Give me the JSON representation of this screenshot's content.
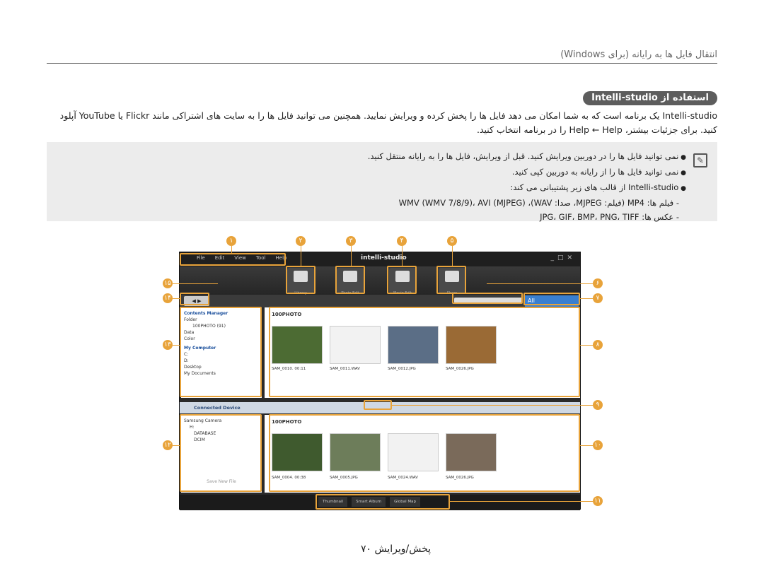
{
  "header": {
    "title": "انتقال فایل ها به رایانه (برای Windows)"
  },
  "section": {
    "title": "استفاده از Intelli-studio"
  },
  "intro": {
    "line1": "Intelli-studio یک برنامه است که به شما امکان می دهد فایل ها را پخش کرده و ویرایش نمایید. همچنین می توانید فایل ها را به سایت های اشتراکی مانند Flickr یا YouTube آپلود",
    "line2": "کنید. برای جزئیات بیشتر، Help ← Help را در برنامه انتخاب کنید."
  },
  "notes": {
    "icon": "note-icon",
    "items": [
      "نمی توانید فایل ها را در دوربین ویرایش کنید. قبل از ویرایش، فایل ها را به رایانه منتقل کنید.",
      "نمی توانید فایل ها را از رایانه به دوربین کپی کنید.",
      "Intelli-studio از قالب های زیر پشتیبانی می کند:",
      "فیلم ها: MP4 (فیلم: MJPEG، صدا: WAV)، WMV (WMV 7/8/9)، AVI (MJPEG)",
      "عکس ها: JPG، GIF، BMP، PNG، TIFF"
    ]
  },
  "app": {
    "menu": [
      "File",
      "Edit",
      "View",
      "Tool",
      "Help"
    ],
    "logo": "intelli-studio",
    "toolbar": [
      "Library",
      "Photo Edit",
      "Movie Edit",
      "Share"
    ],
    "view_label": "All",
    "tree_top": [
      "Contents Manager",
      "Folder",
      "100PHOTO",
      "Data",
      "Color",
      "My Computer",
      "C:",
      "D:",
      "Desktop",
      "My Documents"
    ],
    "tree_count": "(91)",
    "folder_top": "100PHOTO",
    "captions_top": [
      "SAM_0010.",
      "00:11",
      "SAM_0011.WAV",
      "SAM_0012.JPG",
      "SAM_0026.JPG"
    ],
    "connected": "Connected Device",
    "tree_bottom": [
      "Samsung Camera",
      "H:",
      "DATABASE",
      "DCIM"
    ],
    "save_btn": "Save New File",
    "folder_bottom": "100PHOTO",
    "captions_bottom": [
      "SAM_0004.",
      "00:38",
      "SAM_0005.JPG",
      "SAM_0024.WAV",
      "SAM_0026.JPG"
    ],
    "bottom_tabs": [
      "Thumbnail",
      "Smart Album",
      "Global Map"
    ]
  },
  "callouts": {
    "top": [
      "۱",
      "۲",
      "۳",
      "۴",
      "۵"
    ],
    "right": [
      "۶",
      "۷",
      "۸",
      "۹",
      "۱۰",
      "۱۱"
    ],
    "left": [
      "۱۵",
      "۱۴",
      "۱۳",
      "۱۲"
    ]
  },
  "footer": {
    "page": "پخش/ویرایش ۷۰"
  }
}
